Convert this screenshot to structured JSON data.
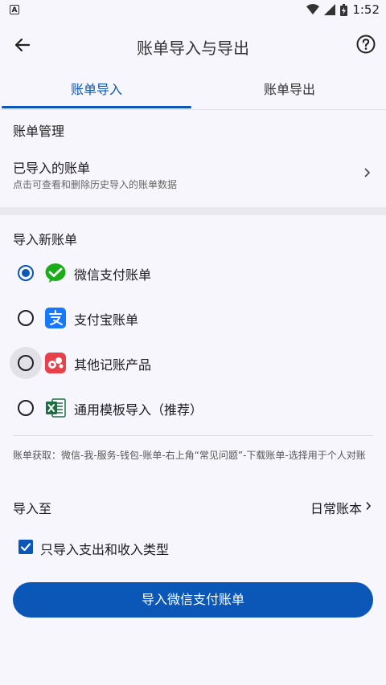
{
  "status": {
    "time": "1:52",
    "a_label": "A"
  },
  "appbar": {
    "title": "账单导入与导出"
  },
  "tabs": [
    {
      "label": "账单导入",
      "active": true
    },
    {
      "label": "账单导出",
      "active": false
    }
  ],
  "manage": {
    "section": "账单管理",
    "imported_title": "已导入的账单",
    "imported_subtitle": "点击可查看和删除历史导入的账单数据"
  },
  "import_new": {
    "section": "导入新账单",
    "options": [
      {
        "label": "微信支付账单",
        "icon": "wechat-pay-icon",
        "selected": true
      },
      {
        "label": "支付宝账单",
        "icon": "alipay-icon",
        "selected": false
      },
      {
        "label": "其他记账产品",
        "icon": "other-bookkeeping-icon",
        "selected": false
      },
      {
        "label": "通用模板导入（推荐）",
        "icon": "excel-icon",
        "selected": false
      }
    ]
  },
  "hint": "账单获取：微信-我-服务-钱包-账单-右上角“常见问题”-下载账单-选择用于个人对账",
  "import_to": {
    "label": "导入至",
    "value": "日常账本"
  },
  "only_expense_income": {
    "label": "只导入支出和收入类型",
    "checked": true
  },
  "primary_button": {
    "label": "导入微信支付账单"
  },
  "colors": {
    "accent": "#0a57b8",
    "wechat": "#1aad19",
    "alipay": "#1677ff",
    "other": "#e8414c",
    "excel": "#1d6f42"
  }
}
